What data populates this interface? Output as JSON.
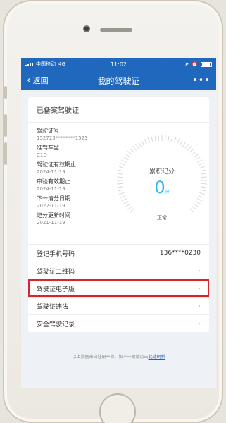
{
  "status": {
    "carrier": "中国移动",
    "network": "4G",
    "time": "11:02"
  },
  "nav": {
    "back_label": "返回",
    "title": "我的驾驶证",
    "more": "•••"
  },
  "card": {
    "title": "已备案驾驶证",
    "fields": [
      {
        "label": "驾驶证号",
        "value": "152723********1523"
      },
      {
        "label": "准驾车型",
        "value": "C1D"
      },
      {
        "label": "驾驶证有效期止",
        "value": "2024-11-19"
      },
      {
        "label": "审验有效期止",
        "value": "2024-11-19"
      },
      {
        "label": "下一清分日期",
        "value": "2022-11-19"
      },
      {
        "label": "记分更新时间",
        "value": "2021-11-19"
      }
    ],
    "gauge": {
      "label": "累积记分",
      "value": "0",
      "unit": "分",
      "status": "正常"
    }
  },
  "rows": {
    "phone": {
      "label": "登记手机号码",
      "value": "136****0230"
    },
    "qr": "驾驶证二维码",
    "ecert": "驾驶证电子版",
    "violation": "驾驶证违法",
    "record": "安全驾驶记录"
  },
  "footer": {
    "text": "以上数据来自注册平台，如不一致请点击",
    "link": "此处刷新"
  },
  "colors": {
    "primary": "#1f68bd",
    "accent": "#34b6ea",
    "highlight": "#d6262b"
  }
}
